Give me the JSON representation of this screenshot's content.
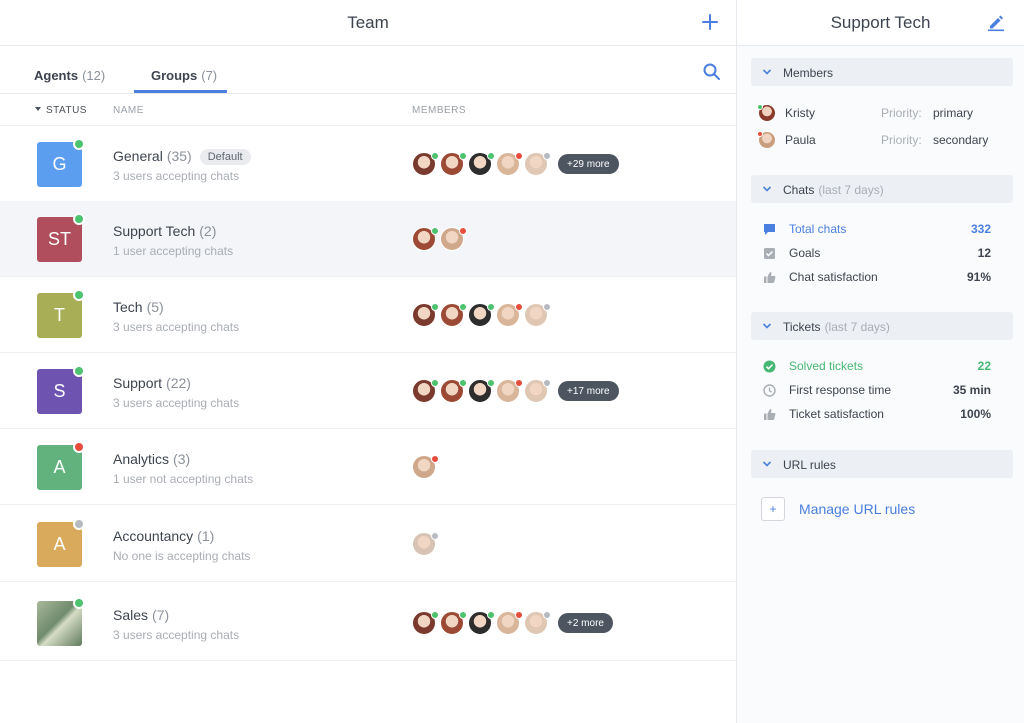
{
  "colors": {
    "accent": "#4a7fe0",
    "online": "#4cc36f",
    "offline": "#e74c3c",
    "away": "#b6bac0",
    "more_pill": "#4d5560"
  },
  "team": {
    "title": "Team",
    "add_icon": "plus-icon",
    "search_icon": "search-icon",
    "tabs": [
      {
        "label": "Agents",
        "count": "(12)",
        "active": false
      },
      {
        "label": "Groups",
        "count": "(7)",
        "active": true
      }
    ],
    "columns": {
      "status": "STATUS",
      "name": "NAME",
      "members": "MEMBERS"
    },
    "groups": [
      {
        "initials": "G",
        "color": "#5b9ef0",
        "status": "online",
        "name": "General",
        "count": "(35)",
        "badge": "Default",
        "sub": "3 users accepting chats",
        "more": "+29 more"
      },
      {
        "initials": "ST",
        "color": "#b04e5d",
        "status": "online",
        "name": "Support Tech",
        "count": "(2)",
        "badge": "",
        "sub": "1 user accepting chats",
        "more": ""
      },
      {
        "initials": "T",
        "color": "#a8ae55",
        "status": "online",
        "name": "Tech",
        "count": "(5)",
        "badge": "",
        "sub": "3 users accepting chats",
        "more": ""
      },
      {
        "initials": "S",
        "color": "#6e53b1",
        "status": "online",
        "name": "Support",
        "count": "(22)",
        "badge": "",
        "sub": "3 users accepting chats",
        "more": "+17 more"
      },
      {
        "initials": "A",
        "color": "#62b27e",
        "status": "offline",
        "name": "Analytics",
        "count": "(3)",
        "badge": "",
        "sub": "1 user not accepting chats",
        "more": ""
      },
      {
        "initials": "A",
        "color": "#d9aa5c",
        "status": "away",
        "name": "Accountancy",
        "count": "(1)",
        "badge": "",
        "sub": "No one is accepting chats",
        "more": ""
      },
      {
        "initials": "",
        "color": "#8aa68e",
        "status": "online",
        "name": "Sales",
        "count": "(7)",
        "badge": "",
        "sub": "3 users accepting chats",
        "more": "+2 more"
      }
    ]
  },
  "detail": {
    "title": "Support Tech",
    "edit_icon": "pencil-icon",
    "members_section": {
      "label": "Members",
      "members": [
        {
          "name": "Kristy",
          "priority_label": "Priority:",
          "priority": "primary",
          "status": "online"
        },
        {
          "name": "Paula",
          "priority_label": "Priority:",
          "priority": "secondary",
          "status": "offline"
        }
      ]
    },
    "chats_section": {
      "label": "Chats",
      "sub": "(last 7 days)",
      "rows": [
        {
          "icon": "chat-bubble-icon",
          "label": "Total chats",
          "value": "332"
        },
        {
          "icon": "goal-checkbox-icon",
          "label": "Goals",
          "value": "12"
        },
        {
          "icon": "thumbs-up-icon",
          "label": "Chat satisfaction",
          "value": "91%"
        }
      ]
    },
    "tickets_section": {
      "label": "Tickets",
      "sub": "(last 7 days)",
      "rows": [
        {
          "icon": "check-circle-icon",
          "label": "Solved tickets",
          "value": "22"
        },
        {
          "icon": "clock-icon",
          "label": "First response time",
          "value": "35 min"
        },
        {
          "icon": "thumbs-up-icon",
          "label": "Ticket satisfaction",
          "value": "100%"
        }
      ]
    },
    "url_section": {
      "label": "URL rules",
      "manage_label": "Manage URL rules",
      "manage_box": "+"
    }
  }
}
